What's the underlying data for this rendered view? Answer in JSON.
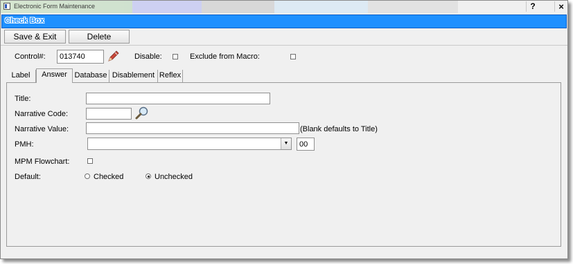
{
  "window": {
    "title": "Electronic Form Maintenance",
    "help_label": "?",
    "close_label": "×"
  },
  "header": {
    "title": "Check Box"
  },
  "toolbar": {
    "save_exit_label": "Save & Exit",
    "delete_label": "Delete"
  },
  "control": {
    "control_label": "Control#:",
    "control_value": "013740",
    "disable_label": "Disable:",
    "disable_checked": false,
    "exclude_label": "Exclude from Macro:",
    "exclude_checked": false
  },
  "tabs": [
    {
      "label": "Label",
      "active": false
    },
    {
      "label": "Answer",
      "active": true
    },
    {
      "label": "Database",
      "active": false
    },
    {
      "label": "Disablement",
      "active": false
    },
    {
      "label": "Reflex",
      "active": false
    }
  ],
  "answer": {
    "title_label": "Title:",
    "title_value": "",
    "narrative_code_label": "Narrative Code:",
    "narrative_code_value": "",
    "narrative_value_label": "Narrative Value:",
    "narrative_value_value": "",
    "narrative_value_hint": "(Blank defaults to Title)",
    "pmh_label": "PMH:",
    "pmh_selected": "",
    "pmh_number": "00",
    "mpm_label": "MPM Flowchart:",
    "mpm_checked": false,
    "default_label": "Default:",
    "default_options": [
      "Checked",
      "Unchecked"
    ],
    "default_selected": "Unchecked"
  },
  "icons": {
    "edit": "pencil-icon",
    "lookup": "magnifier-icon",
    "app": "app-icon"
  },
  "colors": {
    "header_bg": "#1e90ff",
    "panel_bg": "#f0f0f0"
  }
}
